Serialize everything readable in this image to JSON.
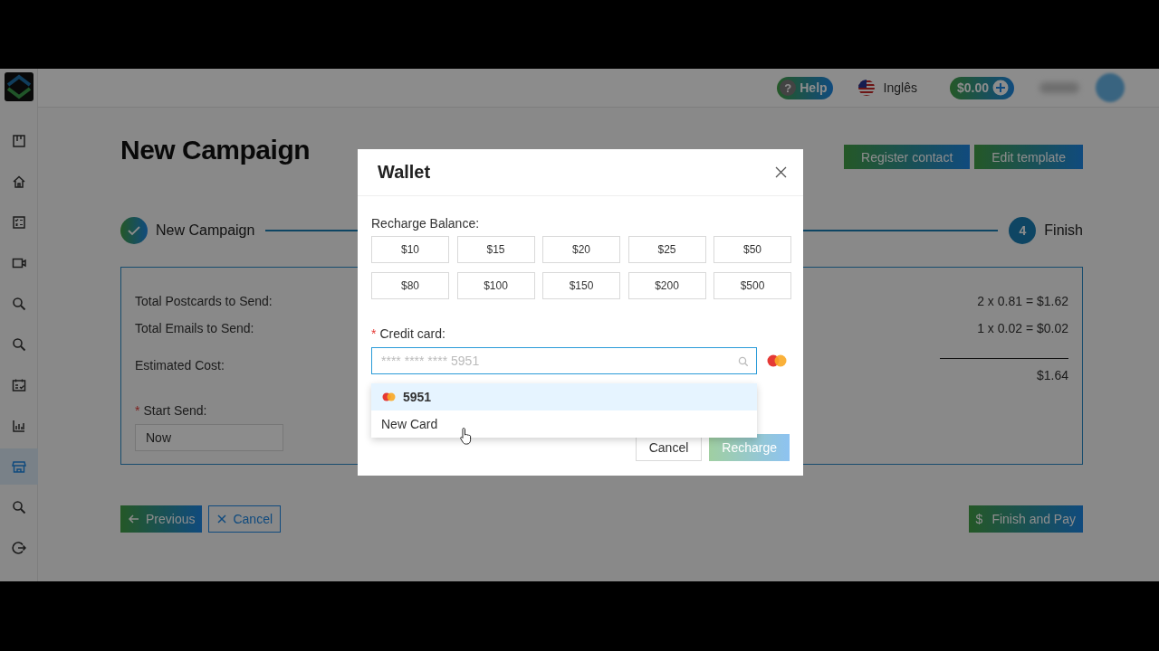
{
  "top_bar": {
    "help_icon": "?",
    "help": "Help",
    "language": "Inglês",
    "balance": "$0.00"
  },
  "sidebar": {
    "items": [
      {
        "kind": "board",
        "selected": false
      },
      {
        "kind": "home",
        "selected": false
      },
      {
        "kind": "checklist",
        "selected": false
      },
      {
        "kind": "video",
        "selected": false
      },
      {
        "kind": "search",
        "selected": false
      },
      {
        "kind": "search",
        "selected": false
      },
      {
        "kind": "calendar",
        "selected": false
      },
      {
        "kind": "chart",
        "selected": false
      },
      {
        "kind": "store",
        "selected": true
      },
      {
        "kind": "search",
        "selected": false
      },
      {
        "kind": "logout",
        "selected": false
      }
    ]
  },
  "page": {
    "title": "New Campaign",
    "actions": [
      "Register contact",
      "Edit template"
    ],
    "steps": [
      {
        "label": "New Campaign",
        "done": true
      },
      {
        "number": "4",
        "label": "Finish",
        "done": false
      }
    ],
    "summary": [
      {
        "label": "Total Postcards to Send:",
        "value": "2 x 0.81 = $1.62"
      },
      {
        "label": "Total Emails to Send:",
        "value": "1 x 0.02 = $0.02"
      },
      {
        "label": "Estimated Cost:",
        "value": "$1.64",
        "total": true
      }
    ],
    "start_send": {
      "required_mark": "*",
      "label": "Start Send:",
      "value": "Now"
    },
    "buttons": [
      {
        "label": "Previous",
        "kind": "back"
      },
      {
        "label": "Cancel",
        "kind": "cancel"
      },
      {
        "label": "Finish and Pay",
        "kind": "pay",
        "icon": "$"
      }
    ]
  },
  "wallet": {
    "title": "Wallet",
    "recharge_label": "Recharge Balance:",
    "amounts": [
      {
        "label": "$10",
        "selected": false
      },
      {
        "label": "$15",
        "selected": false
      },
      {
        "label": "$20",
        "selected": false
      },
      {
        "label": "$25",
        "selected": false
      },
      {
        "label": "$50",
        "selected": false
      },
      {
        "label": "$80",
        "selected": false
      },
      {
        "label": "$100",
        "selected": false
      },
      {
        "label": "$150",
        "selected": false
      },
      {
        "label": "$200",
        "selected": false
      },
      {
        "label": "$500",
        "selected": false
      }
    ],
    "credit_card": {
      "required_mark": "*",
      "label": "Credit card:",
      "placeholder": "**** **** **** 5951"
    },
    "options": [
      {
        "label": "5951",
        "kind": "card",
        "selected": true
      },
      {
        "label": "New Card",
        "kind": "new",
        "selected": false
      }
    ],
    "buttons": [
      {
        "label": "Cancel",
        "kind": "secondary",
        "disabled": false
      },
      {
        "label": "Recharge",
        "kind": "primary",
        "disabled": true
      }
    ]
  }
}
